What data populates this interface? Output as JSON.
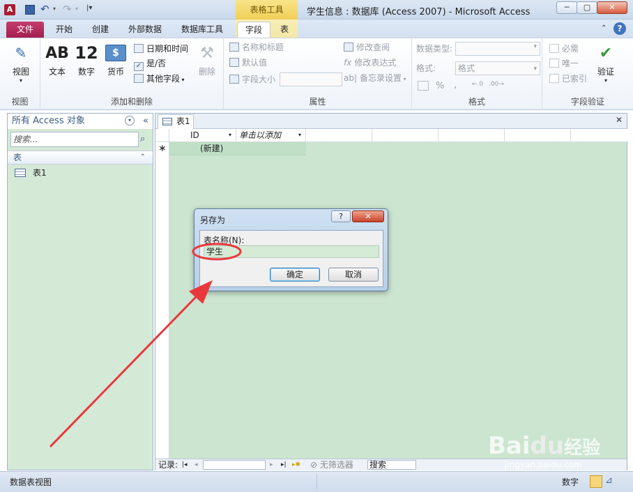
{
  "window": {
    "title": "学生信息 : 数据库 (Access 2007)  -  Microsoft Access",
    "context_header": "表格工具",
    "min_label": "─",
    "max_label": "▢",
    "close_label": "✕"
  },
  "tabs": [
    "文件",
    "开始",
    "创建",
    "外部数据",
    "数据库工具",
    "字段",
    "表"
  ],
  "ribbon": {
    "view": {
      "label": "视图",
      "group": "视图"
    },
    "add_delete": {
      "group": "添加和删除",
      "text_label": "文本",
      "number_label": "数字",
      "currency_label": "货币",
      "datetime_label": "日期和时间",
      "yesno_label": "是/否",
      "more_fields_label": "其他字段",
      "delete_label": "删除",
      "ab_glyph": "AB",
      "num_glyph": "12"
    },
    "properties": {
      "group": "属性",
      "name_caption": "名称和标题",
      "default_value": "默认值",
      "field_size": "字段大小",
      "modify_lookups": "修改查阅",
      "modify_expression": "修改表达式",
      "memo_settings": "备忘录设置"
    },
    "formatting": {
      "group": "格式",
      "data_type_label": "数据类型:",
      "format_label": "格式:",
      "format_value": "格式",
      "percent": "%",
      "comma": ","
    },
    "validation": {
      "group": "字段验证",
      "required": "必需",
      "unique": "唯一",
      "indexed": "已索引",
      "validation_label": "验证"
    }
  },
  "nav": {
    "header": "所有 Access 对象",
    "search_placeholder": "搜索...",
    "section": "表",
    "item": "表1"
  },
  "document": {
    "tab": "表1",
    "columns": [
      "ID",
      "单击以添加"
    ],
    "new_row": "(新建)",
    "new_marker": "∗"
  },
  "record_bar": {
    "label": "记录:",
    "no_filter": "无筛选器",
    "search": "搜索"
  },
  "status": {
    "left": "数据表视图",
    "mode": "数字"
  },
  "dialog": {
    "title": "另存为",
    "help": "?",
    "field_label": "表名称(N):",
    "field_value": "学生",
    "ok": "确定",
    "cancel": "取消"
  },
  "colors": {
    "file_tab": "#a21f50",
    "context_tab": "#f0cf57",
    "grid_background": "#cce5d0",
    "annotation": "#e8393d"
  },
  "watermark": {
    "brand": "Bai",
    "brand2": "经验",
    "url": "jingyan.baidu.com"
  }
}
